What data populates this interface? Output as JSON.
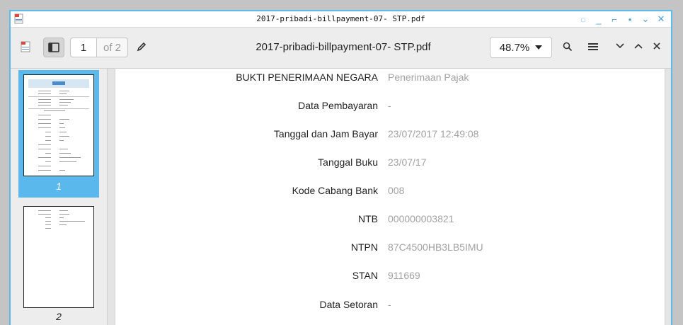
{
  "window": {
    "title": "2017-pribadi-billpayment-07- STP.pdf",
    "controls": [
      "◌",
      "_",
      "⌐",
      "•",
      "⌄",
      "✕"
    ]
  },
  "toolbar": {
    "current_page": "1",
    "page_total": "of 2",
    "document_title": "2017-pribadi-billpayment-07- STP.pdf",
    "zoom": "48.7%"
  },
  "sidebar": {
    "thumbnails": [
      {
        "label": "1",
        "selected": true
      },
      {
        "label": "2",
        "selected": false
      }
    ]
  },
  "document": {
    "rows": [
      {
        "label": "BUKTI PENERIMAAN NEGARA",
        "value": "Penerimaan Pajak"
      },
      {
        "label": "Data Pembayaran",
        "value": "-"
      },
      {
        "label": "Tanggal dan Jam Bayar",
        "value": "23/07/2017 12:49:08"
      },
      {
        "label": "Tanggal Buku",
        "value": "23/07/17"
      },
      {
        "label": "Kode Cabang Bank",
        "value": "008"
      },
      {
        "label": "NTB",
        "value": "000000003821"
      },
      {
        "label": "NTPN",
        "value": "87C4500HB3LB5IMU"
      },
      {
        "label": "STAN",
        "value": "911669"
      },
      {
        "label": "Data Setoran",
        "value": "-"
      }
    ]
  },
  "colors": {
    "accent": "#5bbcea",
    "selected_thumbnail": "#5ab8ec",
    "value_text": "#a2a2a2"
  }
}
